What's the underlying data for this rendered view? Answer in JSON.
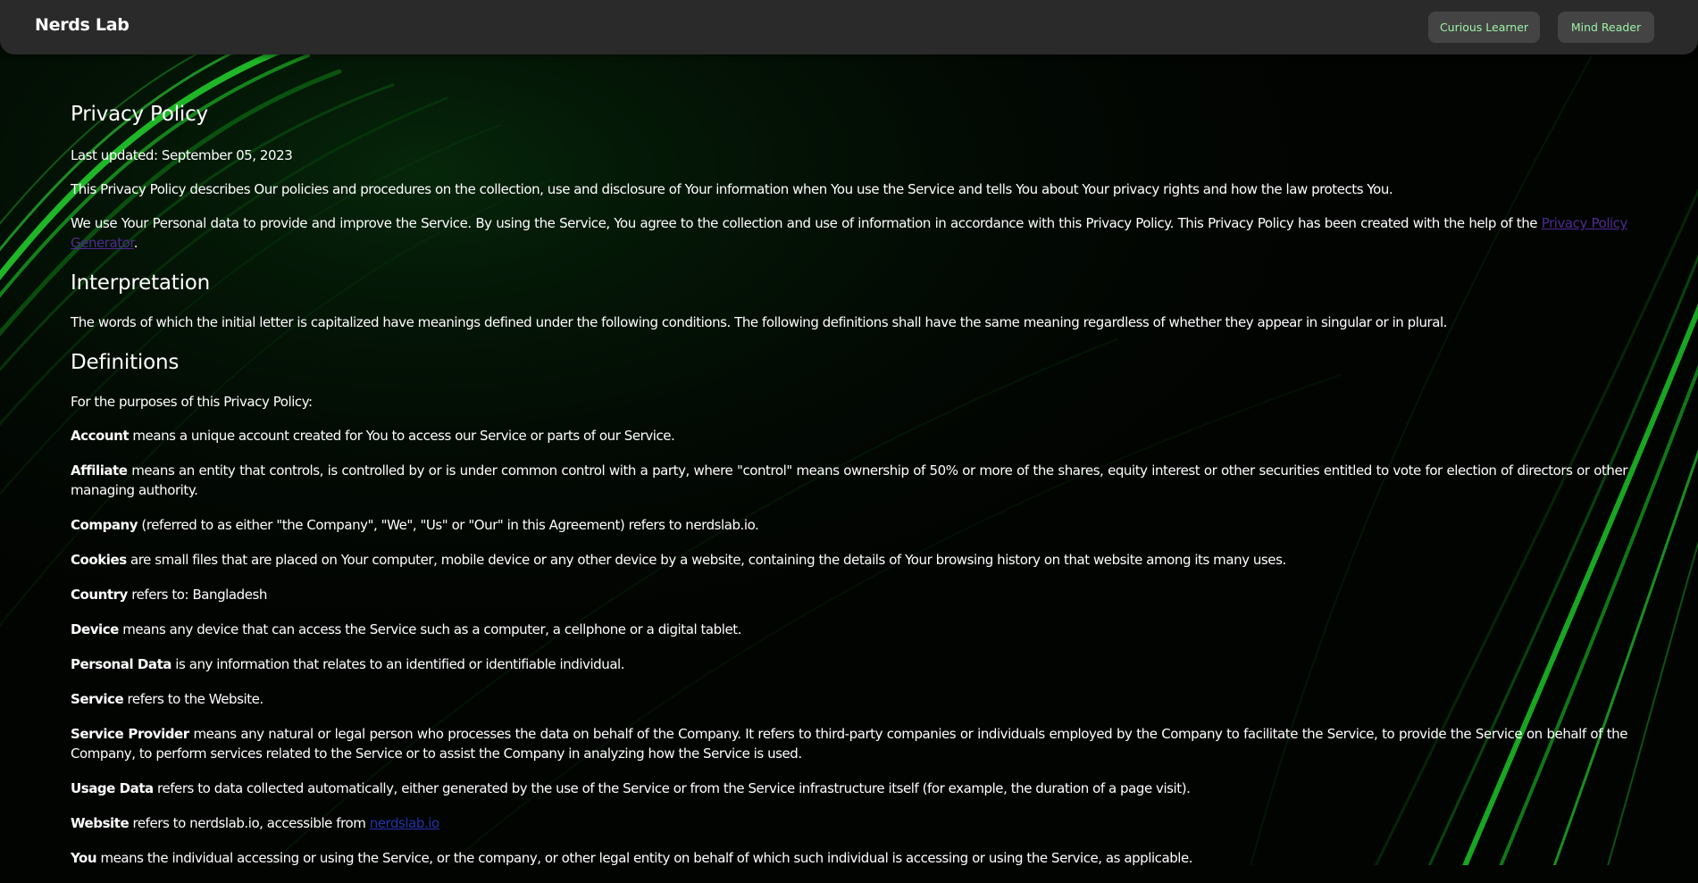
{
  "navbar": {
    "brand": "Nerds Lab",
    "buttons": [
      "Curious Learner",
      "Mind Reader"
    ]
  },
  "theme": {
    "navbar_bg": "#2a2a2a",
    "button_bg": "#444444",
    "button_text": "#9ef0a6",
    "background": "#020402",
    "accent_green": "#22c22a"
  },
  "policy": {
    "title": "Privacy Policy",
    "last_updated": "Last updated: September 05, 2023",
    "intro": "This Privacy Policy describes Our policies and procedures on the collection, use and disclosure of Your information when You use the Service and tells You about Your privacy rights and how the law protects You.",
    "usage_text": "We use Your Personal data to provide and improve the Service. By using the Service, You agree to the collection and use of information in accordance with this Privacy Policy. This Privacy Policy has been created with the help of the ",
    "generator_link": "Privacy Policy Generator",
    "usage_end": ".",
    "interpretation_heading": "Interpretation",
    "interpretation_text": "The words of which the initial letter is capitalized have meanings defined under the following conditions. The following definitions shall have the same meaning regardless of whether they appear in singular or in plural.",
    "definitions_heading": "Definitions",
    "definitions_intro": "For the purposes of this Privacy Policy:",
    "definitions": [
      {
        "term": "Account",
        "text": " means a unique account created for You to access our Service or parts of our Service."
      },
      {
        "term": "Affiliate",
        "text": " means an entity that controls, is controlled by or is under common control with a party, where \"control\" means ownership of 50% or more of the shares, equity interest or other securities entitled to vote for election of directors or other managing authority."
      },
      {
        "term": "Company",
        "text": " (referred to as either \"the Company\", \"We\", \"Us\" or \"Our\" in this Agreement) refers to nerdslab.io."
      },
      {
        "term": "Cookies",
        "text": " are small files that are placed on Your computer, mobile device or any other device by a website, containing the details of Your browsing history on that website among its many uses."
      },
      {
        "term": "Country",
        "text": " refers to: Bangladesh"
      },
      {
        "term": "Device",
        "text": " means any device that can access the Service such as a computer, a cellphone or a digital tablet."
      },
      {
        "term": "Personal Data",
        "text": " is any information that relates to an identified or identifiable individual."
      },
      {
        "term": "Service",
        "text": " refers to the Website."
      },
      {
        "term": "Service Provider",
        "text": " means any natural or legal person who processes the data on behalf of the Company. It refers to third-party companies or individuals employed by the Company to facilitate the Service, to provide the Service on behalf of the Company, to perform services related to the Service or to assist the Company in analyzing how the Service is used."
      },
      {
        "term": "Usage Data",
        "text": " refers to data collected automatically, either generated by the use of the Service or from the Service infrastructure itself (for example, the duration of a page visit)."
      },
      {
        "term": "Website",
        "text": " refers to nerdslab.io, accessible from ",
        "link": "nerdslab.io"
      },
      {
        "term": "You",
        "text": " means the individual accessing or using the Service, or the company, or other legal entity on behalf of which such individual is accessing or using the Service, as applicable."
      }
    ]
  }
}
